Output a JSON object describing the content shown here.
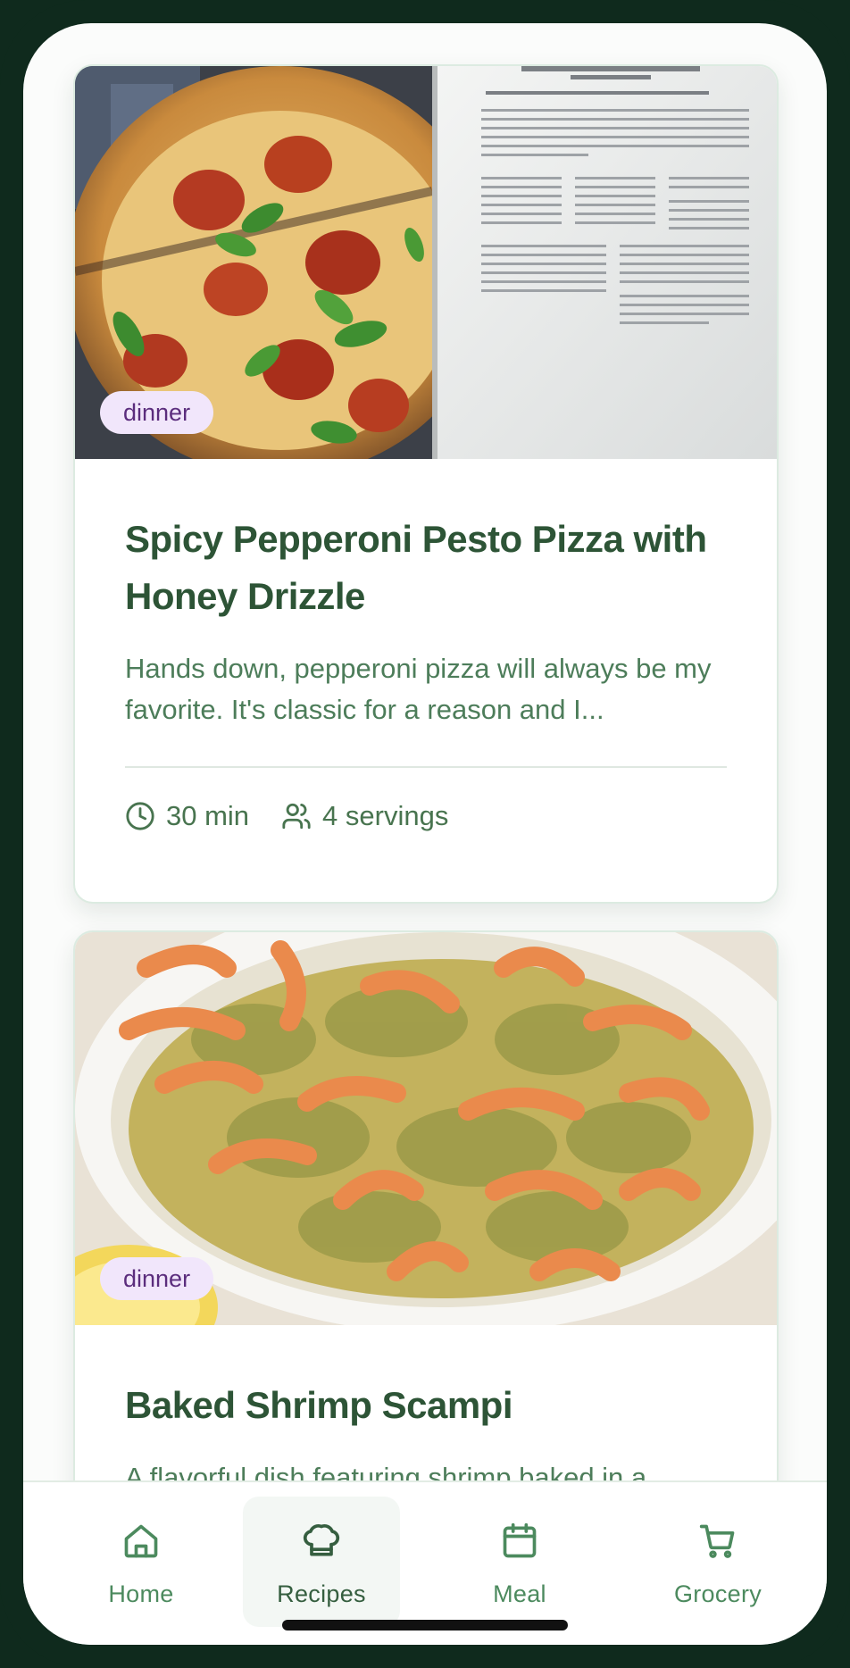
{
  "recipes": [
    {
      "tag": "dinner",
      "title": "Spicy Pepperoni Pesto Pizza with Honey Drizzle",
      "description": "Hands down, pepperoni pizza will always be my favorite. It's classic for a reason and I...",
      "time": "30 min",
      "servings": "4 servings",
      "image_icon": "pizza-photo"
    },
    {
      "tag": "dinner",
      "title": "Baked Shrimp Scampi",
      "description": "A flavorful dish featuring shrimp baked in a",
      "image_icon": "shrimp-photo"
    }
  ],
  "nav": {
    "items": [
      {
        "label": "Home",
        "icon": "home-icon"
      },
      {
        "label": "Recipes",
        "icon": "chef-hat-icon",
        "active": true
      },
      {
        "label": "Meal",
        "icon": "calendar-icon"
      },
      {
        "label": "Grocery",
        "icon": "cart-icon"
      }
    ]
  },
  "colors": {
    "accent": "#2d5436",
    "tag_bg": "#f1e6fb",
    "tag_text": "#5b2d7d",
    "nav_text": "#4c8a5e"
  }
}
